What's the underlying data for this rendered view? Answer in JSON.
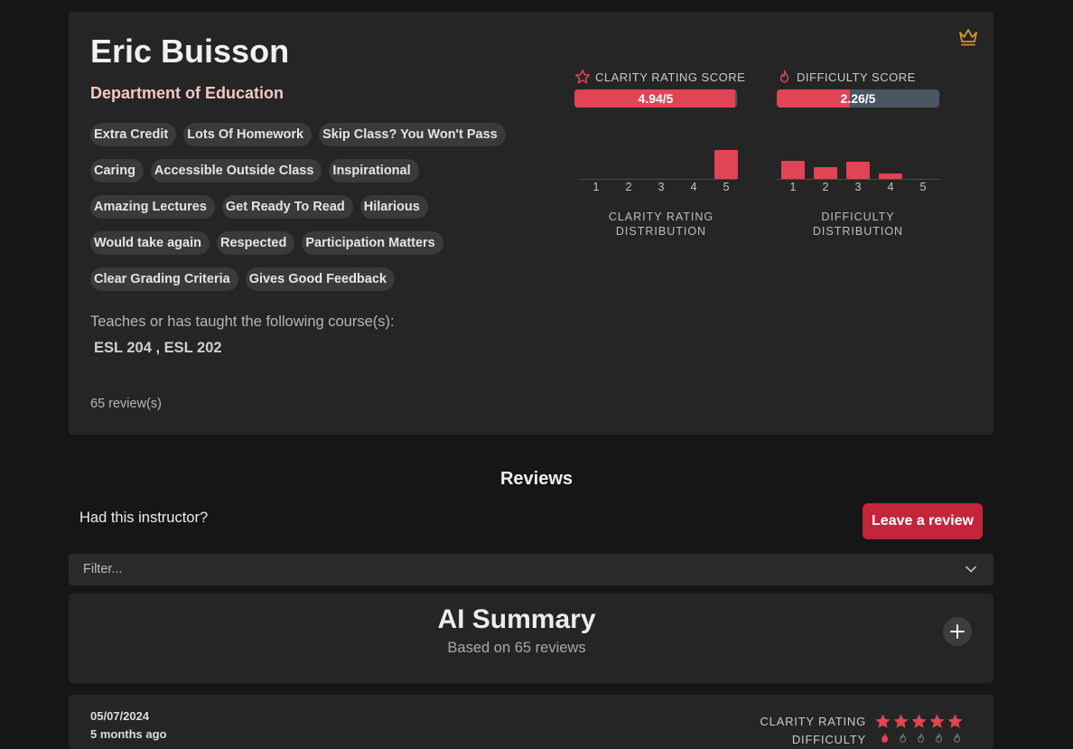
{
  "professor": {
    "name": "Eric Buisson",
    "department": "Department of Education",
    "tags": [
      [
        "Extra Credit",
        "Lots Of Homework",
        "Skip Class? You Won't Pass"
      ],
      [
        "Caring",
        "Accessible Outside Class",
        "Inspirational"
      ],
      [
        "Amazing Lectures",
        "Get Ready To Read",
        "Hilarious"
      ],
      [
        "Would take again",
        "Respected",
        "Participation Matters"
      ],
      [
        "Clear Grading Criteria",
        "Gives Good Feedback"
      ]
    ],
    "teaches_label": "Teaches or has taught the following course(s):",
    "courses": "ESL 204 , ESL 202",
    "review_count": "65 review(s)",
    "premium_icon": "crown-icon"
  },
  "clarity": {
    "label": "CLARITY RATING SCORE",
    "icon": "star-outline-icon",
    "score_text": "4.94/5",
    "score": 4.94,
    "max": 5,
    "distribution": [
      0,
      0,
      0,
      0,
      1.0
    ],
    "dist_labels": [
      "1",
      "2",
      "3",
      "4",
      "5"
    ],
    "dist_title": "CLARITY RATING DISTRIBUTION"
  },
  "difficulty": {
    "label": "DIFFICULTY SCORE",
    "icon": "flame-icon",
    "score_text": "2.26/5",
    "score": 2.26,
    "max": 5,
    "distribution": [
      0.62,
      0.4,
      0.6,
      0.19,
      0
    ],
    "dist_labels": [
      "1",
      "2",
      "3",
      "4",
      "5"
    ],
    "dist_title": "DIFFICULTY DISTRIBUTION"
  },
  "colors": {
    "accent": "#e04455",
    "button": "#c3253b",
    "bar_track": "#4a5563",
    "department": "#f3c6c6",
    "crown": "#d4932c"
  },
  "reviews_section": {
    "title": "Reviews",
    "prompt": "Had this instructor?",
    "leave_button": "Leave a review",
    "filter_placeholder": "Filter...",
    "filter_icon": "chevron-down-icon"
  },
  "ai_summary": {
    "title": "AI Summary",
    "subtitle": "Based on 65 reviews",
    "expand_icon": "plus-icon"
  },
  "review": {
    "date": "05/07/2024",
    "ago": "5 months ago",
    "clarity_label": "CLARITY RATING",
    "clarity_stars": 5,
    "difficulty_label": "DIFFICULTY",
    "difficulty_level": 1
  }
}
